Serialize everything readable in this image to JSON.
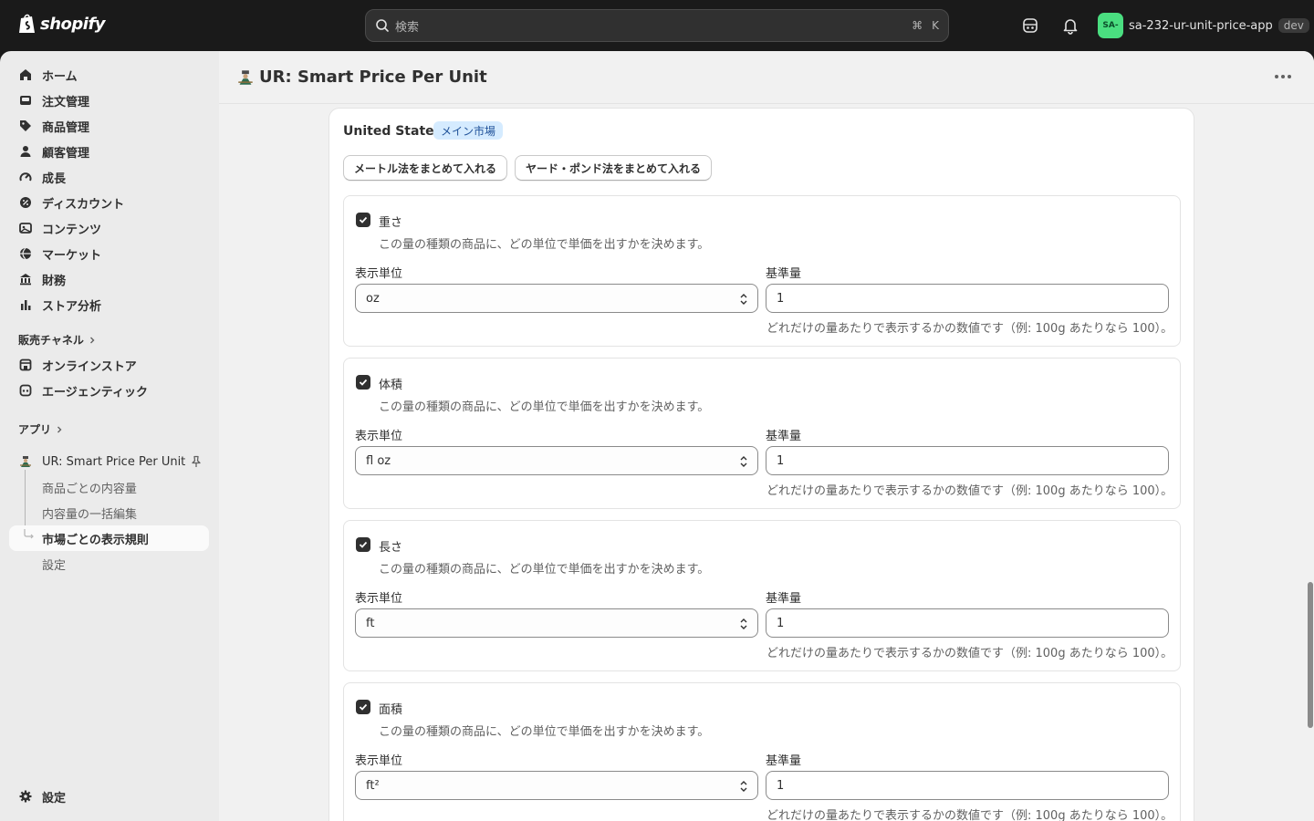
{
  "topbar": {
    "logo_text": "shopify",
    "search_placeholder": "検索",
    "search_shortcut_cmd": "⌘",
    "search_shortcut_key": "K",
    "store_avatar": "SA-",
    "store_name": "sa-232-ur-unit-price-app",
    "store_badge": "dev"
  },
  "sidebar": {
    "items": [
      {
        "label": "ホーム",
        "icon": "home-icon"
      },
      {
        "label": "注文管理",
        "icon": "inbox-icon"
      },
      {
        "label": "商品管理",
        "icon": "tag-icon"
      },
      {
        "label": "顧客管理",
        "icon": "person-icon"
      },
      {
        "label": "成長",
        "icon": "gauge-icon"
      },
      {
        "label": "ディスカウント",
        "icon": "discount-icon"
      },
      {
        "label": "コンテンツ",
        "icon": "content-icon"
      },
      {
        "label": "マーケット",
        "icon": "globe-icon"
      },
      {
        "label": "財務",
        "icon": "bank-icon"
      },
      {
        "label": "ストア分析",
        "icon": "chart-bar-icon"
      }
    ],
    "sales_channels_label": "販売チャネル",
    "channels": [
      {
        "label": "オンラインストア",
        "icon": "store-icon"
      },
      {
        "label": "エージェンティック",
        "icon": "agentic-icon"
      }
    ],
    "apps_label": "アプリ",
    "app": {
      "label": "UR: Smart Price Per Unit",
      "subitems": [
        "商品ごとの内容量",
        "内容量の一括編集",
        "市場ごとの表示規則",
        "設定"
      ],
      "active_index": 2
    },
    "settings_label": "設定"
  },
  "header": {
    "title": "UR: Smart Price Per Unit"
  },
  "market": {
    "name": "United States",
    "badge": "メイン市場",
    "metric_button": "メートル法をまとめて入れる",
    "imperial_button": "ヤード・ポンド法をまとめて入れる"
  },
  "unit_groups": [
    {
      "label": "重さ",
      "checked": true,
      "description": "この量の種類の商品に、どの単位で単価を出すかを決めます。",
      "unit_label": "表示単位",
      "unit_value": "oz",
      "base_label": "基準量",
      "base_value": "1",
      "help": "どれだけの量あたりで表示するかの数値です（例: 100g あたりなら 100）。"
    },
    {
      "label": "体積",
      "checked": true,
      "description": "この量の種類の商品に、どの単位で単価を出すかを決めます。",
      "unit_label": "表示単位",
      "unit_value": "fl oz",
      "base_label": "基準量",
      "base_value": "1",
      "help": "どれだけの量あたりで表示するかの数値です（例: 100g あたりなら 100）。"
    },
    {
      "label": "長さ",
      "checked": true,
      "description": "この量の種類の商品に、どの単位で単価を出すかを決めます。",
      "unit_label": "表示単位",
      "unit_value": "ft",
      "base_label": "基準量",
      "base_value": "1",
      "help": "どれだけの量あたりで表示するかの数値です（例: 100g あたりなら 100）。"
    },
    {
      "label": "面積",
      "checked": true,
      "description": "この量の種類の商品に、どの単位で単価を出すかを決めます。",
      "unit_label": "表示単位",
      "unit_value": "ft²",
      "base_label": "基準量",
      "base_value": "1",
      "help": "どれだけの量あたりで表示するかの数値です（例: 100g あたりなら 100）。"
    }
  ],
  "colors": {
    "topbar": "#1a1a1a",
    "sidebar": "#ebebeb",
    "main": "#f1f1f1",
    "badge_bg": "#d5ebff",
    "avatar": "#4ade80"
  }
}
